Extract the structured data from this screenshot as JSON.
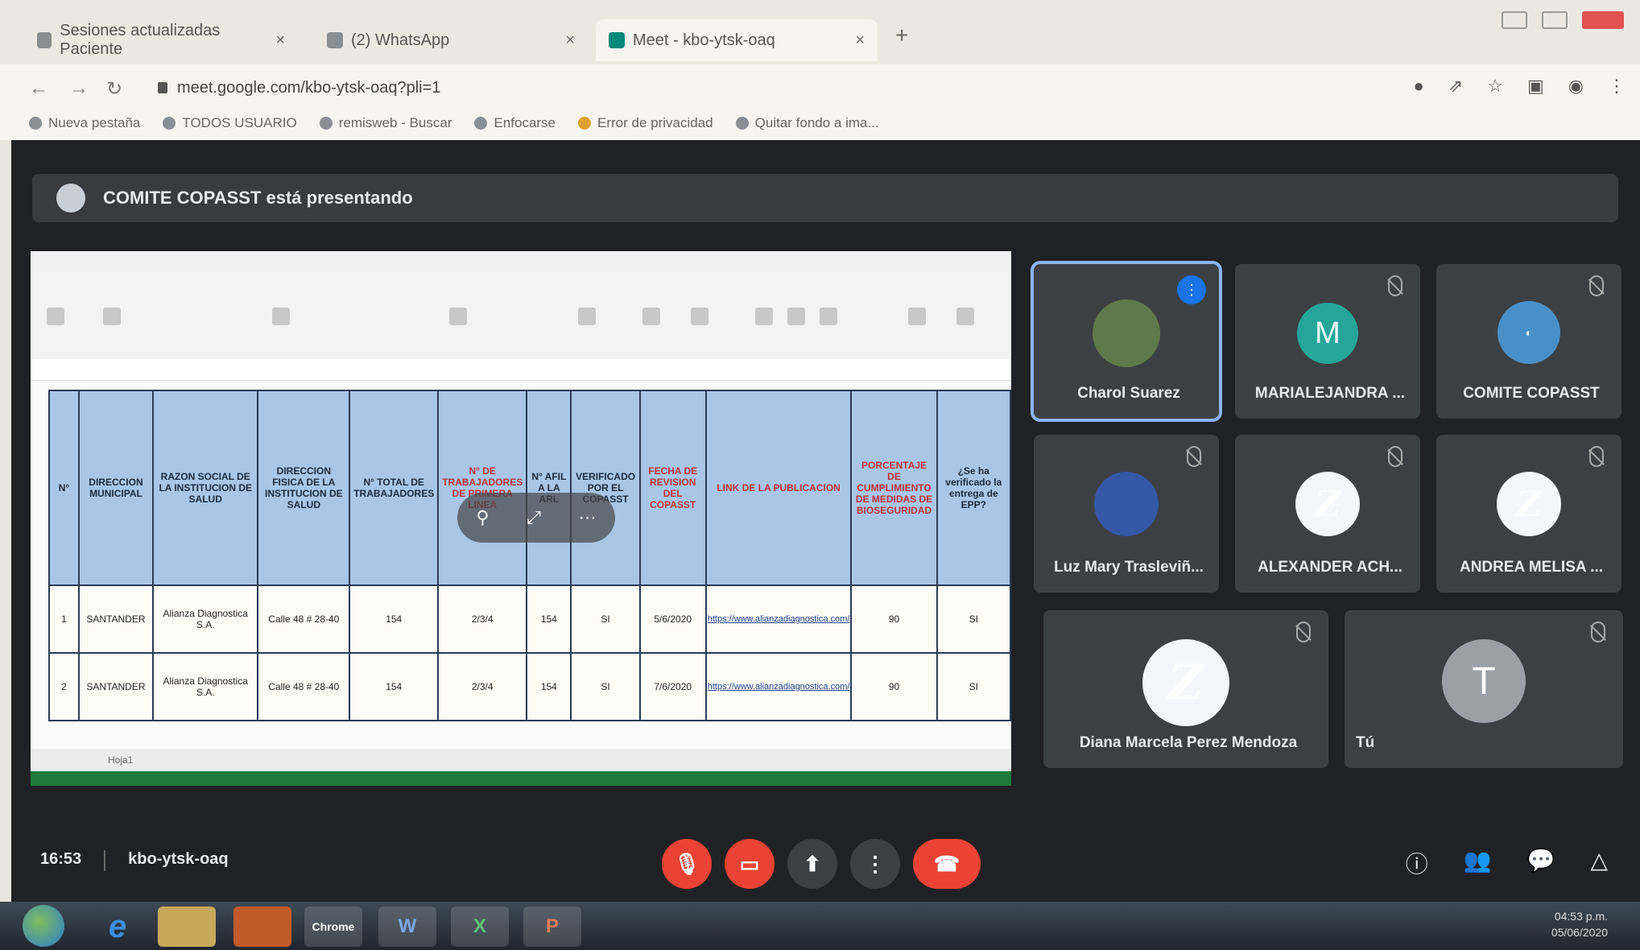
{
  "browser": {
    "tabs": [
      {
        "label": "Sesiones actualizadas Paciente",
        "active": false
      },
      {
        "label": "(2) WhatsApp",
        "active": false
      },
      {
        "label": "Meet - kbo-ytsk-oaq",
        "active": true
      }
    ],
    "url": "meet.google.com/kbo-ytsk-oaq?pli=1",
    "bookmarks": [
      "Nueva pestaña",
      "TODOS USUARIO",
      "remisweb - Buscar",
      "Enfocarse",
      "Error de privacidad",
      "Quitar fondo a ima..."
    ]
  },
  "meet": {
    "presenter_text": "COMITE COPASST está presentando",
    "meeting_time": "16:53",
    "meeting_code": "kbo-ytsk-oaq",
    "participants": [
      {
        "name": "Charol Suarez",
        "initial": "",
        "color": "#5f7a4a",
        "speaking": true
      },
      {
        "name": "MARIALEJANDRA ...",
        "initial": "M",
        "color": "#26a69a",
        "speaking": false
      },
      {
        "name": "COMITE COPASST",
        "initial": "",
        "color": "#4a90c8",
        "speaking": false
      },
      {
        "name": "Luz Mary Trasleviñ...",
        "initial": "",
        "color": "#3557a8",
        "speaking": false
      },
      {
        "name": "ALEXANDER ACH...",
        "initial": "",
        "color": "#f4f6fa",
        "speaking": false
      },
      {
        "name": "ANDREA MELISA ...",
        "initial": "",
        "color": "#f4f6fa",
        "speaking": false
      },
      {
        "name": "Diana Marcela Perez Mendoza",
        "initial": "",
        "color": "#f4f6fa",
        "speaking": false
      },
      {
        "name": "Tú",
        "initial": "T",
        "color": "#9aa0a6",
        "speaking": false
      }
    ]
  },
  "spreadsheet": {
    "headers": [
      {
        "text": "N°",
        "red": false
      },
      {
        "text": "DIRECCION MUNICIPAL",
        "red": false
      },
      {
        "text": "RAZON SOCIAL DE LA INSTITUCION DE SALUD",
        "red": false
      },
      {
        "text": "DIRECCION FISICA DE LA INSTITUCION DE SALUD",
        "red": false
      },
      {
        "text": "N° TOTAL DE TRABAJADORES",
        "red": false
      },
      {
        "text": "N° DE TRABAJADORES DE PRIMERA LINEA",
        "red": true
      },
      {
        "text": "N° AFIL A LA ARL",
        "red": false
      },
      {
        "text": "VERIFICADO POR EL COPASST",
        "red": false
      },
      {
        "text": "FECHA DE REVISION DEL COPASST",
        "red": true
      },
      {
        "text": "LINK DE LA PUBLICACION",
        "red": true
      },
      {
        "text": "PORCENTAJE DE CUMPLIMIENTO DE MEDIDAS DE BIOSEGURIDAD",
        "red": true
      },
      {
        "text": "¿Se ha verificado la entrega de EPP?",
        "red": false
      }
    ],
    "rows": [
      [
        "1",
        "SANTANDER",
        "Alianza Diagnostica S.A.",
        "Calle 48 # 28-40",
        "154",
        "2/3/4",
        "154",
        "SI",
        "5/6/2020",
        "https://www.alianzadiagnostica.com/",
        "90",
        "SI"
      ],
      [
        "2",
        "SANTANDER",
        "Alianza Diagnostica S.A.",
        "Calle 48 # 28-40",
        "154",
        "2/3/4",
        "154",
        "SI",
        "7/6/2020",
        "https://www.alianzadiagnostica.com/",
        "90",
        "SI"
      ]
    ],
    "sheet_tab": "Hoja1"
  },
  "taskbar": {
    "apps": [
      "e",
      "Chrome",
      "W",
      "X",
      "P"
    ],
    "time": "04:53 p.m.",
    "date": "05/06/2020"
  }
}
